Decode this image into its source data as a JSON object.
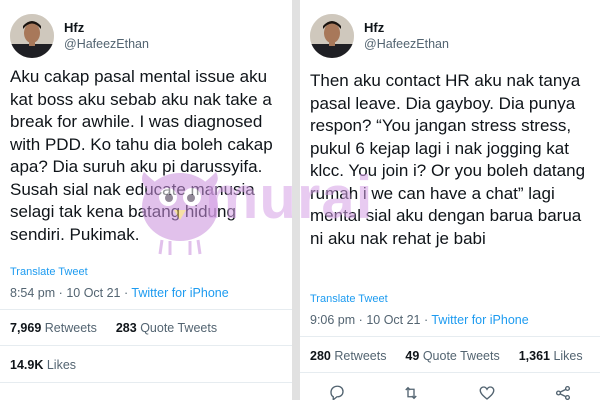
{
  "left_tweet": {
    "author": {
      "name": "Hfz",
      "handle": "@HafeezEthan"
    },
    "text": "Aku cakap pasal mental issue aku kat boss aku sebab aku nak take a break for awhile. I was diagnosed with PDD. Ko tahu dia boleh cakap apa? Dia suruh aku pi darussyifa. Susah sial nak educate manusia selagi tak kena batang hidung sendiri. Pukimak.",
    "translate_label": "Translate Tweet",
    "time": "8:54 pm",
    "date": "10 Oct 21",
    "separator": "·",
    "source": "Twitter for iPhone",
    "stats": {
      "retweets_count": "7,969",
      "retweets_label": "Retweets",
      "quotes_count": "283",
      "quotes_label": "Quote Tweets",
      "likes_count": "14.9K",
      "likes_label": "Likes"
    }
  },
  "right_tweet": {
    "author": {
      "name": "Hfz",
      "handle": "@HafeezEthan"
    },
    "text": "Then aku contact HR aku nak tanya pasal leave. Dia gayboy. Dia punya respon? “You jangan stress stress, pukul 6 kejap lagi i nak jogging kat klcc. You join i? Or you boleh datang rumah i we can have a chat” lagi mental sial aku dengan barua barua ni aku nak rehat je babi",
    "translate_label": "Translate Tweet",
    "time": "9:06 pm",
    "date": "10 Oct 21",
    "separator": "·",
    "source": "Twitter for iPhone",
    "stats": {
      "retweets_count": "280",
      "retweets_label": "Retweets",
      "quotes_count": "49",
      "quotes_label": "Quote Tweets",
      "likes_count": "1,361",
      "likes_label": "Likes"
    },
    "actions": [
      "reply-icon",
      "retweet-icon",
      "like-icon",
      "share-icon"
    ]
  },
  "watermark": {
    "text": "murai"
  },
  "colors": {
    "link": "#1d9bf0",
    "text": "#0f1419",
    "muted": "#536471",
    "watermark": "#d6a0e6"
  }
}
